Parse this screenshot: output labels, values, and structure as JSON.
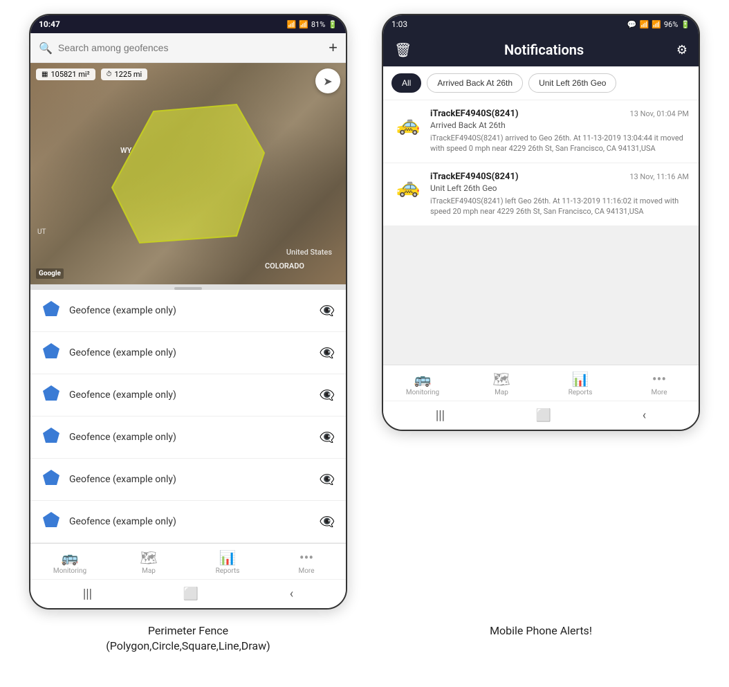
{
  "left_phone": {
    "status_bar": {
      "time": "10:47",
      "wifi": "WiFi",
      "signal": "81%",
      "battery": "81%"
    },
    "search": {
      "placeholder": "Search among geofences"
    },
    "map": {
      "stat1": "105821 mi²",
      "stat2": "1225 mi",
      "labels": {
        "us": "United States",
        "colorado": "COLORADO",
        "wyoming": "WY",
        "utah": "UT"
      },
      "google": "Google"
    },
    "geofence_items": [
      {
        "name": "Geofence (example only)"
      },
      {
        "name": "Geofence (example only)"
      },
      {
        "name": "Geofence (example only)"
      },
      {
        "name": "Geofence (example only)"
      },
      {
        "name": "Geofence (example only)"
      },
      {
        "name": "Geofence (example only)"
      }
    ],
    "nav": {
      "items": [
        {
          "label": "Monitoring",
          "icon": "🚌"
        },
        {
          "label": "Map",
          "icon": "🗺"
        },
        {
          "label": "Reports",
          "icon": "📊"
        },
        {
          "label": "More",
          "icon": "···"
        }
      ]
    },
    "caption": "Perimeter Fence\n(Polygon,Circle,Square,Line,Draw)"
  },
  "right_phone": {
    "status_bar": {
      "time": "1:03",
      "chat_icon": "💬",
      "signal": "96%",
      "battery": "96%"
    },
    "header": {
      "title": "Notifications",
      "trash_icon": "🗑",
      "settings_icon": "⚙"
    },
    "filters": [
      {
        "label": "All",
        "active": true
      },
      {
        "label": "Arrived Back At 26th",
        "active": false
      },
      {
        "label": "Unit Left 26th Geo",
        "active": false
      }
    ],
    "notifications": [
      {
        "device": "iTrackEF4940S(8241)",
        "time": "13 Nov, 01:04 PM",
        "event": "Arrived Back At 26th",
        "desc": "iTrackEF4940S(8241) arrived to Geo 26th.    At 11-13-2019 13:04:44 it moved with speed 0 mph near 4229 26th St, San Francisco, CA 94131,USA"
      },
      {
        "device": "iTrackEF4940S(8241)",
        "time": "13 Nov, 11:16 AM",
        "event": "Unit Left 26th Geo",
        "desc": "iTrackEF4940S(8241) left Geo 26th.    At 11-13-2019 11:16:02 it moved with speed 20 mph near 4229 26th St, San Francisco, CA 94131,USA"
      }
    ],
    "nav": {
      "items": [
        {
          "label": "Monitoring",
          "icon": "🚌"
        },
        {
          "label": "Map",
          "icon": "🗺"
        },
        {
          "label": "Reports",
          "icon": "📊"
        },
        {
          "label": "More",
          "icon": "···"
        }
      ]
    },
    "caption": "Mobile Phone Alerts!"
  }
}
